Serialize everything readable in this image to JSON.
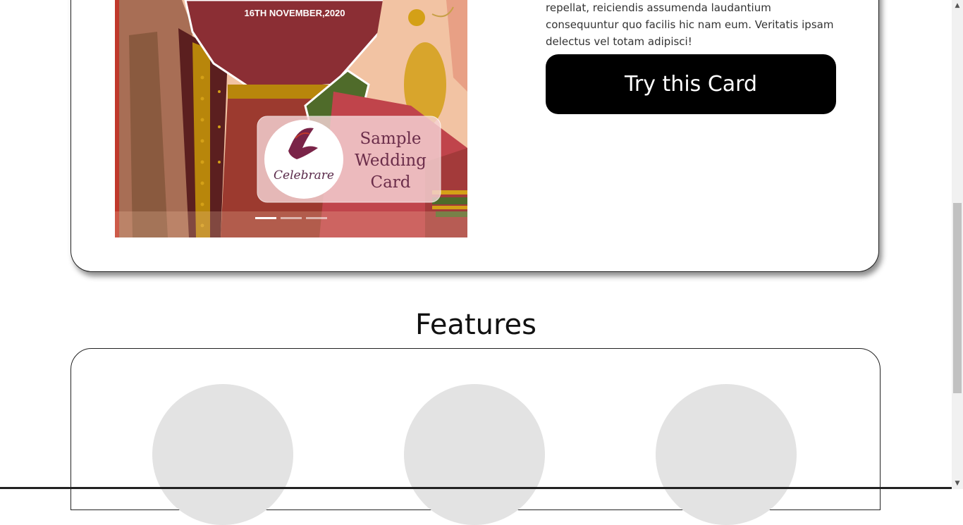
{
  "sample_card": {
    "date_text": "16TH NOVEMBER,2020",
    "logo_text": "Celebrare",
    "label_line1": "Sample",
    "label_line2": "Wedding",
    "label_line3": "Card",
    "carousel": {
      "slide_count": 3,
      "active_index": 0
    }
  },
  "description": {
    "text": "repellat, reiciendis assumenda laudantium consequuntur quo facilis hic nam eum. Veritatis ipsam delectus vel totam adipisci!"
  },
  "cta": {
    "label": "Try this Card"
  },
  "features": {
    "title": "Features"
  },
  "colors": {
    "button_bg": "#000000",
    "button_text": "#ffffff",
    "feature_placeholder": "#e3e3e3"
  }
}
